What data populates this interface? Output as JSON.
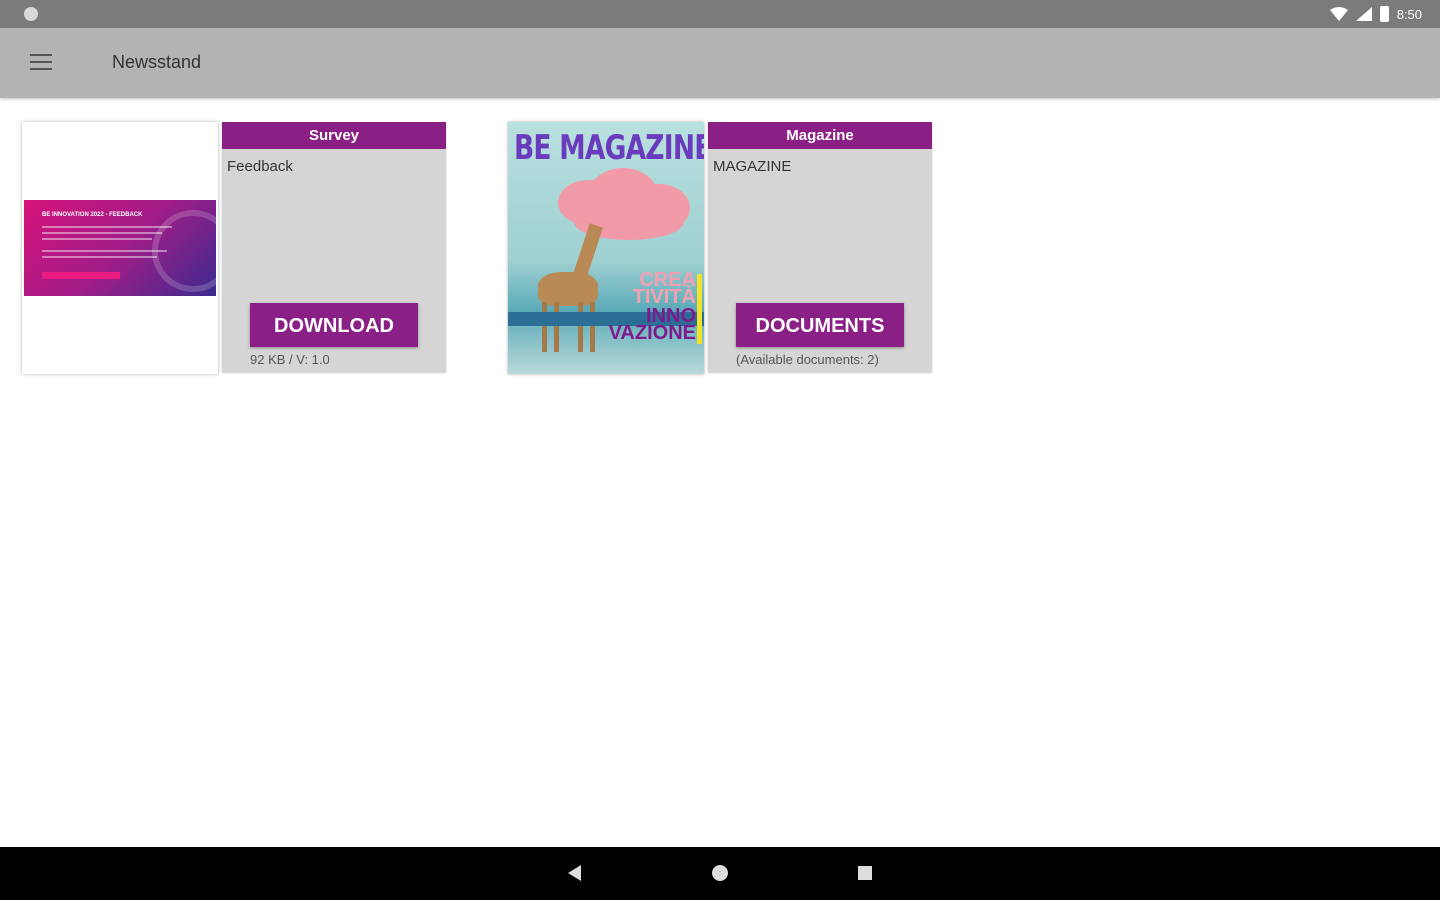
{
  "status_bar": {
    "time": "8:50"
  },
  "app_bar": {
    "title": "Newsstand"
  },
  "cards": [
    {
      "category": "Survey",
      "subtitle": "Feedback",
      "button_label": "DOWNLOAD",
      "meta": "92 KB / V: 1.0",
      "cover_title": "BE INNOVATION 2022 - FEEDBACK"
    },
    {
      "category": "Magazine",
      "subtitle": "MAGAZINE",
      "button_label": "DOCUMENTS",
      "meta": "(Available documents: 2)",
      "cover_brand": "BE MAGAZINE",
      "cover_text_1": "CREA TIVITÀ",
      "cover_text_2": "INNO VAZIONE"
    }
  ],
  "colors": {
    "accent": "#8a1f85",
    "app_bar": "#b3b3b3",
    "status_bar": "#7b7b7b",
    "panel": "#d5d5d5"
  },
  "icons": {
    "menu": "hamburger-icon",
    "back": "back-icon",
    "home": "home-icon",
    "recents": "recents-icon"
  }
}
